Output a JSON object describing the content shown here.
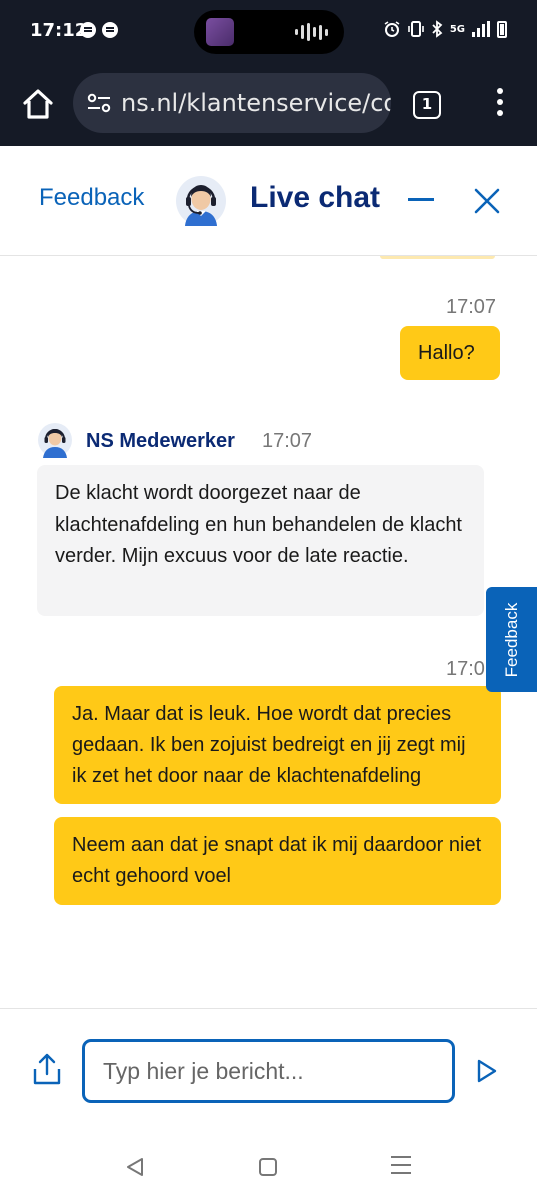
{
  "status_bar": {
    "time": "17:12",
    "left_icons": [
      "spotify-icon",
      "audio-icon"
    ],
    "right_icons": [
      "alarm-icon",
      "vibrate-icon",
      "bluetooth-icon",
      "5g-signal-icon",
      "signal-icon",
      "battery-icon"
    ],
    "network_label": "5G"
  },
  "browser": {
    "url": "ns.nl/klantenservice/con",
    "tab_count": "1"
  },
  "chat_header": {
    "feedback_label": "Feedback",
    "title": "Live chat"
  },
  "messages": [
    {
      "from": "user",
      "time": "17:07",
      "text": "Hallo?"
    },
    {
      "from": "agent",
      "sender": "NS Medewerker",
      "time": "17:07",
      "text": "De klacht wordt doorgezet naar de klachtenafdeling en hun behandelen de klacht verder. Mijn excuus voor de late reactie."
    },
    {
      "from": "user",
      "time": "17:0",
      "text": "Ja. Maar dat is leuk. Hoe wordt dat precies gedaan. Ik ben zojuist bedreigt en jij zegt mij ik zet het door naar de klachtenafdeling"
    },
    {
      "from": "user",
      "text": "Neem aan dat je snapt dat ik mij daardoor niet echt gehoord voel"
    }
  ],
  "side_tab": {
    "label": "Feedback"
  },
  "composer": {
    "placeholder": "Typ hier je bericht..."
  },
  "colors": {
    "brand_blue": "#0a63b8",
    "title_navy": "#0b2a74",
    "user_bubble": "#ffc917",
    "agent_bubble": "#f4f4f5",
    "system_bar": "#151a26"
  }
}
